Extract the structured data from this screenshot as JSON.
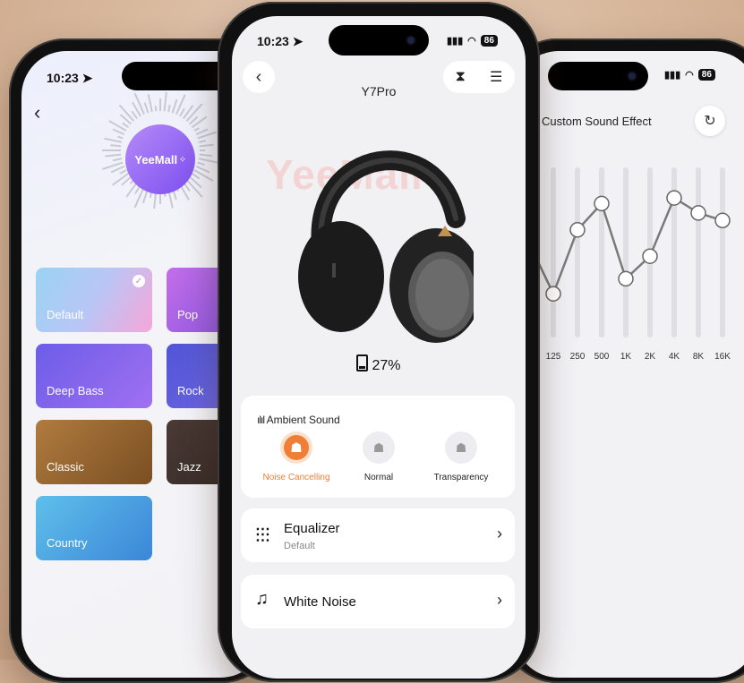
{
  "status_bar": {
    "time": "10:23",
    "battery": "86"
  },
  "equalizer_presets": {
    "items": [
      {
        "label": "Default",
        "selected": true
      },
      {
        "label": "Pop"
      },
      {
        "label": "Deep Bass"
      },
      {
        "label": "Rock"
      },
      {
        "label": "Classic"
      },
      {
        "label": "Jazz"
      },
      {
        "label": "Country"
      }
    ],
    "logo_text": "YeeMall"
  },
  "device": {
    "title": "Y7Pro",
    "battery_percent": "27%",
    "watermark": "YeeMall"
  },
  "ambient_sound": {
    "title": "Ambient Sound",
    "modes": [
      {
        "label": "Noise Cancelling",
        "active": true,
        "icon": "noise-cancelling-icon"
      },
      {
        "label": "Normal",
        "active": false,
        "icon": "normal-mode-icon"
      },
      {
        "label": "Transparency",
        "active": false,
        "icon": "transparency-icon"
      }
    ],
    "accent_color": "#f07e36"
  },
  "menu": {
    "equalizer": {
      "title": "Equalizer",
      "subtitle": "Default"
    },
    "white_noise": {
      "title": "White Noise"
    }
  },
  "custom_eq": {
    "title": "Custom Sound Effect",
    "bands": [
      "125",
      "250",
      "500",
      "1K",
      "2K",
      "4K",
      "8K",
      "16K"
    ],
    "levels": [
      0.28,
      0.62,
      0.76,
      0.36,
      0.48,
      0.79,
      0.71,
      0.67
    ],
    "offscreen_level_left": 0.55
  }
}
